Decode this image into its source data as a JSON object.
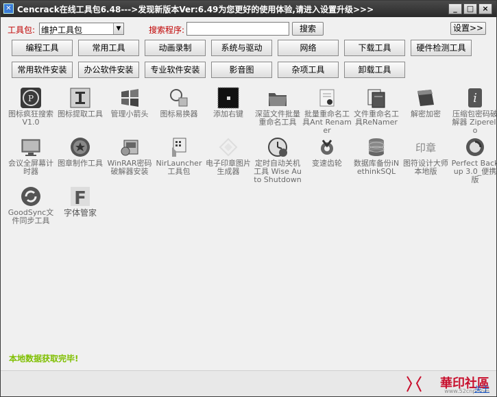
{
  "window": {
    "title": "Cencrack在线工具包6.48--->发现新版本Ver:6.49为您更好的使用体验,请进入设置升级>>>",
    "controls": [
      "_",
      "□",
      "×"
    ]
  },
  "toolbar": {
    "toolkit_label": "工具包:",
    "toolkit_value": "维护工具包",
    "search_label": "搜索程序:",
    "search_value": "",
    "search_button": "搜索",
    "settings_button": "设置>>"
  },
  "nav_row1": [
    "编程工具",
    "常用工具",
    "动画录制",
    "系统与驱动",
    "网络",
    "下载工具",
    "硬件检测工具"
  ],
  "nav_row2": [
    "常用软件安装",
    "办公软件安装",
    "专业软件安装",
    "影音图",
    "杂项工具",
    "卸载工具"
  ],
  "items": [
    {
      "label": "图标疯狂搜索 V1.0",
      "icon": "py-logo-icon"
    },
    {
      "label": "图标提取工具",
      "icon": "i-beam-icon"
    },
    {
      "label": "管理小箭头",
      "icon": "windows-icon"
    },
    {
      "label": "图标易换器",
      "icon": "magnifier-icon"
    },
    {
      "label": "添加右键",
      "icon": "terminal-icon"
    },
    {
      "label": "深蓝文件批量重命名工具",
      "icon": "folder-icon"
    },
    {
      "label": "批量重命名工具Ant Renamer",
      "icon": "ant-renamer-icon"
    },
    {
      "label": "文件重命名工具ReNamer",
      "icon": "renamer-icon"
    },
    {
      "label": "解密加密",
      "icon": "box-icon"
    },
    {
      "label": "压缩包密码破解器 Ziperello",
      "icon": "ziperello-icon"
    },
    {
      "label": "会议全屏幕计时器",
      "icon": "monitor-icon"
    },
    {
      "label": "图章制作工具",
      "icon": "stamp-icon"
    },
    {
      "label": "WinRAR密码破解器安装",
      "icon": "winrar-icon"
    },
    {
      "label": "NirLauncher 工具包",
      "icon": "nirlauncher-icon"
    },
    {
      "label": "电子印章图片生成器",
      "icon": "seal-icon"
    },
    {
      "label": "定时自动关机工具 Wise Auto Shutdown",
      "icon": "shutdown-clock-icon"
    },
    {
      "label": "变速齿轮",
      "icon": "gear-icon"
    },
    {
      "label": "数据库备份iNethinkSQL",
      "icon": "database-icon"
    },
    {
      "label": "图符设计大师本地版",
      "icon": "yinzhang-icon"
    },
    {
      "label": "Perfect Backup 3.0_便携版",
      "icon": "backup-icon"
    },
    {
      "label": "GoodSync文件同步工具",
      "icon": "sync-icon"
    },
    {
      "label": "字体管家",
      "icon": "font-icon"
    }
  ],
  "status_text": "本地数据获取完毕!",
  "footer": {
    "logo_text": "華印社區",
    "logo_url": "www.52cnp.com",
    "about": "关于"
  },
  "colors": {
    "title_bar": "#2a2a2a",
    "label_red": "#c00000",
    "status_green": "#7fbf00",
    "item_label_gray": "#6a6a6a"
  }
}
